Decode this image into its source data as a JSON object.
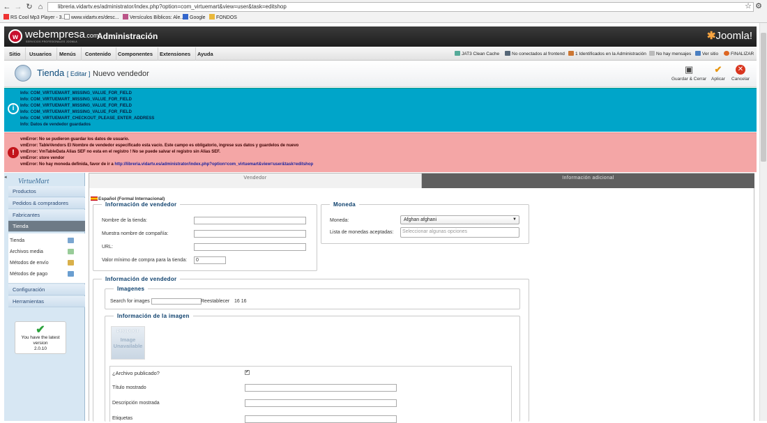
{
  "browser": {
    "url": "libreria.vidartv.es/administrator/index.php?option=com_virtuemart&view=user&task=editshop",
    "bookmarks": [
      "RS Cool Mp3 Player - 3...",
      "www.vidartv.es/desc...",
      "Versículos Bíblicos: Ale...",
      "Google",
      "FONDOS"
    ]
  },
  "header": {
    "brand": "webempresa",
    "brand_suffix": ".com",
    "brand_sub": "SERVICIOS PROFESIONALES JOOMLA",
    "title": "Administración",
    "joomla": "Joomla!"
  },
  "menu": {
    "items": [
      "Sitio",
      "Usuarios",
      "Menús",
      "Contenido",
      "Componentes",
      "Extensiones",
      "Ayuda"
    ],
    "status": {
      "jat3": "JAT3 Clean Cache",
      "frontend": "No conectados al frontend",
      "admin": "1 Identificados en la Administración",
      "messages": "No hay mensajes",
      "view_site": "Ver sitio",
      "logout": "FINALIZAR"
    }
  },
  "toolbar": {
    "title": "Tienda",
    "edit": "[ Editar ]",
    "subtitle": "Nuevo vendedor",
    "save_close": "Guardar & Cerrar",
    "apply": "Aplicar",
    "cancel": "Cancelar"
  },
  "info_messages": [
    "Info: COM_VIRTUEMART_MISSING_VALUE_FOR_FIELD",
    "Info: COM_VIRTUEMART_MISSING_VALUE_FOR_FIELD",
    "Info: COM_VIRTUEMART_MISSING_VALUE_FOR_FIELD",
    "Info: COM_VIRTUEMART_MISSING_VALUE_FOR_FIELD",
    "Info: COM_VIRTUEMART_CHECKOUT_PLEASE_ENTER_ADDRESS",
    "Info: Datos de vendedor guardados"
  ],
  "error_messages": [
    "vmError: No se pudieron guardar los datos de usuario.",
    "vmError: TableVendors El Nombre de vendedor especificado esta vacío. Este campo es obligatorio, ingrese sus datos y guardelos de nuevo",
    "vmError: VmTableData Alias SEF no esta en el registro ! No se puede salvar el registro sin Alias SEF.",
    "vmError: store vendor"
  ],
  "error_last": {
    "text": "No hay moneda definida, favor de ir a ",
    "link": "http://libreria.vidartv.es/administrator/index.php?option=com_virtuemart&view=user&task=editshop"
  },
  "sidebar": {
    "logo": "VirtueMart",
    "items": [
      "Productos",
      "Pedidos & compradores",
      "Fabricantes",
      "Tienda"
    ],
    "sub_items": [
      "Tienda",
      "Archivos media",
      "Métodos de envío",
      "Métodos de pago"
    ],
    "bottom_items": [
      "Configuración",
      "Herramientas"
    ],
    "version_text": "You have the latest version",
    "version": "2.0.10"
  },
  "tabs": [
    "Vendedor",
    "Información adicional"
  ],
  "form": {
    "language": "Español (Formal Internacional)",
    "vendor_info_legend": "Información de vendedor",
    "store_name_label": "Nombre de la tienda:",
    "company_name_label": "Muestra nombre de compañía:",
    "url_label": "URL:",
    "min_purchase_label": "Valor mínimo de compra para la tienda:",
    "min_purchase_value": "0",
    "currency_legend": "Moneda",
    "currency_label": "Moneda:",
    "currency_value": "Afghan afghani",
    "accepted_label": "Lista de monedas aceptadas:",
    "accepted_placeholder": "Seleccionar algunas opciones",
    "vendor_info_legend2": "Información de vendedor",
    "images_legend": "Imagenes",
    "search_label": "Search for images",
    "reset_label": "Reestablecer",
    "pager": "16 16",
    "image_info_legend": "Información de la imagen",
    "placeholder_line1": "PRODUCT",
    "placeholder_line2": "Image",
    "placeholder_line3": "Unavailable",
    "published_label": "¿Archivo publicado?",
    "title_label": "Título mostrado",
    "desc_label": "Descripción mostrada",
    "tags_label": "Etiquetas"
  }
}
